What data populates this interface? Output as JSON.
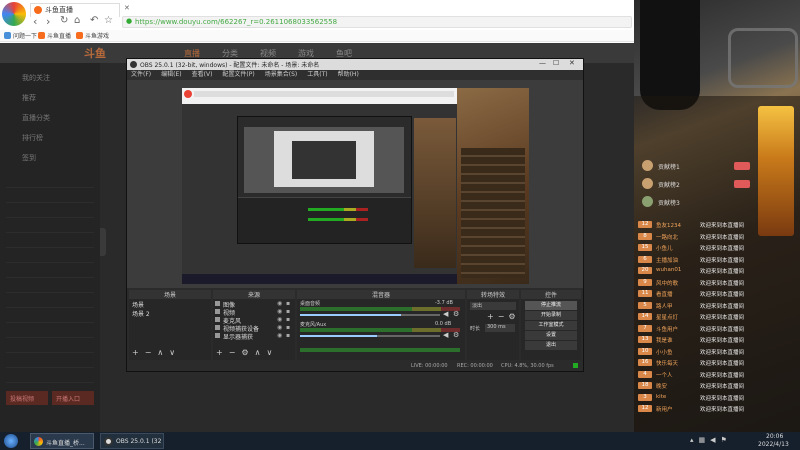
{
  "browser": {
    "tab_title": "斗鱼直播",
    "url": "https://www.douyu.com/662267_r=0.2611068033562558",
    "bookmarks": [
      "问题一下",
      "斗鱼直播",
      "斗鱼游戏"
    ]
  },
  "site": {
    "logo": "斗鱼",
    "nav": [
      "直播",
      "分类",
      "视频",
      "游戏",
      "鱼吧"
    ],
    "sidebar": [
      "我的关注",
      "推荐",
      "直播分类",
      "排行榜",
      "签到"
    ],
    "sidebar_bottom": [
      "投稿视频",
      "开播入口"
    ]
  },
  "obs": {
    "title": "OBS 25.0.1 (32-bit, windows) - 配置文件: 未命名 - 场景: 未命名",
    "menu": [
      "文件(F)",
      "编辑(E)",
      "查看(V)",
      "配置文件(P)",
      "场景集合(S)",
      "工具(T)",
      "帮助(H)"
    ],
    "panels": {
      "scenes": "场景",
      "sources": "来源",
      "mixer": "混音器",
      "transitions": "转场特效",
      "controls": "控件"
    },
    "scene_items": [
      "场景",
      "场景 2"
    ],
    "source_items": [
      "图像",
      "视频",
      "麦克风",
      "视频捕获设备",
      "显示器捕获"
    ],
    "mixer_tracks": [
      {
        "name": "桌面音频",
        "db": "-3.7 dB",
        "level": 0.72
      },
      {
        "name": "麦克风/Aux",
        "db": "0.0 dB",
        "level": 0.55
      }
    ],
    "transition": {
      "type": "淡出",
      "duration_label": "时长",
      "duration": "300 ms"
    },
    "controls": [
      "停止推流",
      "开始录制",
      "工作室模式",
      "设置",
      "退出"
    ],
    "status": {
      "live": "LIVE: 00:00:00",
      "rec": "REC: 00:00:00",
      "cpu": "CPU: 4.8%, 30.00 fps"
    }
  },
  "chat": {
    "messages": [
      {
        "lv": "12",
        "user": "鱼友1234",
        "text": "欢迎来到本直播间"
      },
      {
        "lv": "8",
        "user": "一路向北",
        "text": "欢迎来到本直播间"
      },
      {
        "lv": "15",
        "user": "小鱼儿",
        "text": "欢迎来到本直播间"
      },
      {
        "lv": "6",
        "user": "主播加油",
        "text": "欢迎来到本直播间"
      },
      {
        "lv": "20",
        "user": "wuhan01",
        "text": "欢迎来到本直播间"
      },
      {
        "lv": "9",
        "user": "风中的歌",
        "text": "欢迎来到本直播间"
      },
      {
        "lv": "11",
        "user": "看直播",
        "text": "欢迎来到本直播间"
      },
      {
        "lv": "5",
        "user": "路人甲",
        "text": "欢迎来到本直播间"
      },
      {
        "lv": "14",
        "user": "星星点灯",
        "text": "欢迎来到本直播间"
      },
      {
        "lv": "7",
        "user": "斗鱼用户",
        "text": "欢迎来到本直播间"
      },
      {
        "lv": "13",
        "user": "我是谁",
        "text": "欢迎来到本直播间"
      },
      {
        "lv": "10",
        "user": "小小鱼",
        "text": "欢迎来到本直播间"
      },
      {
        "lv": "16",
        "user": "快乐每天",
        "text": "欢迎来到本直播间"
      },
      {
        "lv": "4",
        "user": "一个人",
        "text": "欢迎来到本直播间"
      },
      {
        "lv": "18",
        "user": "晚安",
        "text": "欢迎来到本直播间"
      },
      {
        "lv": "3",
        "user": "kite",
        "text": "欢迎来到本直播间"
      },
      {
        "lv": "12",
        "user": "新用户",
        "text": "欢迎来到本直播间"
      }
    ],
    "top_users": [
      "贡献榜1",
      "贡献榜2",
      "贡献榜3"
    ]
  },
  "taskbar": {
    "items": [
      "斗鱼直播_桥...",
      "OBS 25.0.1 (32..."
    ],
    "time": "20:06",
    "date": "2022/4/13"
  },
  "colors": {
    "accent": "#f76b1c",
    "obs_bg": "#2b2b2b",
    "obs_panel": "#3a3a3a"
  }
}
